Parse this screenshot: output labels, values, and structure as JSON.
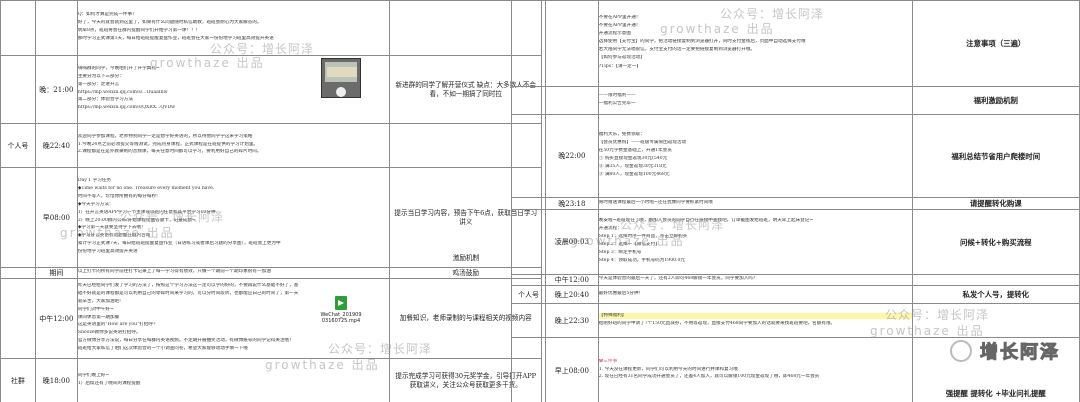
{
  "left": {
    "lines_top": [
      "Q：如何才算是完成一件事？",
      "好了，今天的就会就到这里了，如果有什么问题随时私信助教，班班会耐心为大家解答的。",
      "明早8点，班班将会在群内提醒同学们开始学习第一课！！！",
      "那时学习正式课第1天，每日给班班提醒复盘作业，班班会在大家一份份地学习班里高效提升英语"
    ],
    "lines_21": [
      "嗨嗨群的同学，今晚咱们开了开学典礼~",
      "主要分为以下三部分：",
      "第一部分：走进开言",
      "https://mp.weixin.qq.com/s/...OuaaInw",
      "第二部分：体验营学习方法",
      "https://mp.weixin.qq.com/s/QXRX...QVDw"
    ],
    "lines_2240": [
      "欢迎同学参加课程，老师特别同学一定是想学好英语的，所以待他同学学这米学习策略",
      "1.今晚24点之前必须提交等线测试，完成热身课程，正式课程是在班提供的学习计划里。",
      "2.课程都是在是外教录制的音频课，每天任意时间都可以学习，要利用好自己的碎片时间。"
    ],
    "lines_8": [
      "Day 1 学习任务",
      "◆Time waits for no one. Treasure every moment you have.",
      "时间不等人，珍惜你所拥有的每分每秒！",
      "◆今天学习方法：",
      "1）在开言英语APP学习一节主课或以班内任意和其平台学习10分钟",
      "2）晚上20:00群内公布/开始课程提醒答题卡，记录成绩~",
      "◆学习第一天就要坚持学下去哦！",
      "◆学习开言英语有问题都在群内咨询",
      "累计学习正式课7天，每日给班班提醒复盘作业（日语练习或者课后习题的分享图），班班会上更为中",
      "份份地学习班里高效提升英语"
    ],
    "lines_1200": [
      "以上打卡的所有同学前往打卡记录上了每一学习得有绩效，只做一个期前一个期印象很有一加油",
      "昨天已经给同学们发了学习的方法了，按照这个学习方法这一定可以学的好的，不要再说什么基础不好了，基",
      "础不好就是的课程都是可以利用自己的零碎时间来学习的，可以分时间段听，也都能应白己的时间了，第一天",
      "就辛苦，大家加油吧!",
      "同学们对中午好~",
      "课间休息第一期加餐",
      "这是英语里的\"How are you\"打招呼?",
      "Snooze教你多说英语打招呼。",
      "官方微博分享方法说，每日分享在每群内英语视频。不定期开展抽奖活动，有微博账号的同学记得关注哦！",
      "班班给大家私信了咱们这次体验营的一个小调查问卷，希望大家能够动动手填一下哦"
    ],
    "lines_1800": [
      "同学们晚上好~",
      "1）后续还有了晚间的课程提醒"
    ],
    "lab_21": "晚：21:00",
    "lab_renhao": "个人号",
    "lab_2240": "晚22:40",
    "lab_8": "早08:00",
    "lab_period": "期间",
    "lab_1200": "中午12:00",
    "lab_shequn": "社群",
    "lab_1800": "晚18:00",
    "rem_21": "新进群的同学了解开营仪式 缺点：大多数人不会看，不如一期搞了同时拉",
    "rem_8": "提示当日学习内容，预告下午6点，获取当日学习讲义",
    "rem_period1": "激励机制",
    "rem_period2": "鸡汤鼓励",
    "rem_1200": "加餐知识，老师录制的与课程相关的视频内容",
    "rem_1800": "提示完成学习可获得30元奖学金，引导打开APP获取讲义，关注公众号获取更多干货。",
    "file_name": "WeChat_201909 03160725.mp4"
  },
  "right": {
    "lines_top": [
      "不要在APP里开通！",
      "不要在APP里开通！",
      "开通流程示意图",
      "选择使用【支付宝】的同学，把活动链接复制到浏览器打开，同时支付金钱后，页面中自动选择支付哦",
      "若大陆同学无法唱很信，支付宝支付的话一定要把链接复制到浏览器打开哦。",
      "【如何参与返现活动】",
      "",
      "?Tips：【请一定一】"
    ],
    "lines_fuli": [
      "——限时福利——",
      "一福利公告完毕一"
    ],
    "lines_22": [
      "福利大乐，免费领取：",
      "【会员优惠购】——班级专属限团返现活动",
      "在50元学费金基础上，开通1年会员",
      "① 购买直接现金返现30元(540元",
      "② 满35人，现金返现30元318元",
      "③ 满80人，现金返现100元468元"
    ],
    "lines_2318": [
      "限时赠送课程最后一小时啦~还在犹豫同学要抓紧时间哦"
    ],
    "lines_0003": [
      "晚安啦~班班现在了哦，都加入会员的同学自行在链接中查找吧，订单截图发给班班，明天早上起床登记~",
      "开通流程：",
      "Step 1：选择时序一件商品，点击立即购买",
      "Step 2：选择一【微信支付】",
      "Step 3：绑定手机号",
      "Step 4：领取成功，手机号码为1900.0元"
    ],
    "lines_0800": [
      "今天是体验营的最后一天了，还有2人即可468解锁一年会员，同学要加入吗？",
      "最好优惠最后5分钟！",
      "【特殊福利】",
      "给刚好班的同学申请了7个150元直减券，不用等返现，直接支付468同学要加入的话就要来找班班要吧，名额有限。",
      "✿三件事",
      "1. 今天没在课程更新，同学们可以利用今天的时间进行并课和复习哦",
      "2. 现在已经有31名同学成功开通会员了，还差4人加入，就可以解锁100元现金返现了哦，即468元一年会员"
    ],
    "lab_2200": "晚22:00",
    "lab_2318": "晚23:18",
    "lab_0003": "凌晨00:03",
    "lab_renhao": "个人号",
    "lab_1200": "中午12:00",
    "lab_2040": "晚上20:40",
    "lab_2230": "晚上22:30",
    "lab_0800": "早上08:00",
    "rem_top": "注意事项（三遍）",
    "rem_fuli": "福利激励机制",
    "rem_22": "福利总结节省用户爬楼时间",
    "rem_2318": "请提醒转化购课",
    "rem_0003": "问候+转化+购买流程",
    "rem_1200": "私发个人号，提转化",
    "rem_0800": "强提醒 提转化 +毕业问礼提醒"
  },
  "watermarks": [
    "公众号：增长阿泽",
    "growthaze  出品"
  ],
  "logo_text": "增长阿泽"
}
